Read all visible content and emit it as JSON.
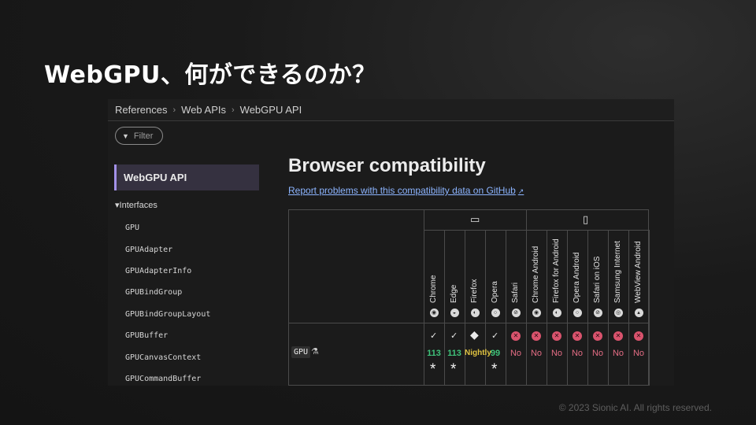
{
  "slide": {
    "title": "WebGPU、何ができるのか？",
    "footer": "© 2023 Sionic AI. All rights reserved."
  },
  "breadcrumb": [
    "References",
    "Web APIs",
    "WebGPU API"
  ],
  "breadcrumb_separator": "›",
  "filter": {
    "label": "Filter",
    "icon": "filter-funnel-icon"
  },
  "sidebar": {
    "active_item": "WebGPU API",
    "group_label": "▾Interfaces",
    "items": [
      "GPU",
      "GPUAdapter",
      "GPUAdapterInfo",
      "GPUBindGroup",
      "GPUBindGroupLayout",
      "GPUBuffer",
      "GPUCanvasContext",
      "GPUCommandBuffer"
    ]
  },
  "content": {
    "heading": "Browser compatibility",
    "report_link": "Report problems with this compatibility data on GitHub"
  },
  "compat_table": {
    "groups": [
      {
        "name": "desktop",
        "icon": "desktop-monitor-icon"
      },
      {
        "name": "mobile",
        "icon": "mobile-phone-icon"
      }
    ],
    "browsers": [
      {
        "name": "Chrome",
        "group": "desktop",
        "icon": "chrome-icon",
        "glyph": "◉",
        "support": "yes",
        "version": "113",
        "note": "*"
      },
      {
        "name": "Edge",
        "group": "desktop",
        "icon": "edge-icon",
        "glyph": "◒",
        "support": "yes",
        "version": "113",
        "note": "*"
      },
      {
        "name": "Firefox",
        "group": "desktop",
        "icon": "firefox-icon",
        "glyph": "◐",
        "support": "preview",
        "version": "Nightly",
        "note": ""
      },
      {
        "name": "Opera",
        "group": "desktop",
        "icon": "opera-icon",
        "glyph": "○",
        "support": "yes",
        "version": "99",
        "note": "*"
      },
      {
        "name": "Safari",
        "group": "desktop",
        "icon": "safari-icon",
        "glyph": "⊘",
        "support": "no",
        "version": "No",
        "note": ""
      },
      {
        "name": "Chrome Android",
        "group": "mobile",
        "icon": "chrome-icon",
        "glyph": "◉",
        "support": "no",
        "version": "No",
        "note": ""
      },
      {
        "name": "Firefox for Android",
        "group": "mobile",
        "icon": "firefox-icon",
        "glyph": "◐",
        "support": "no",
        "version": "No",
        "note": ""
      },
      {
        "name": "Opera Android",
        "group": "mobile",
        "icon": "opera-icon",
        "glyph": "○",
        "support": "no",
        "version": "No",
        "note": ""
      },
      {
        "name": "Safari on iOS",
        "group": "mobile",
        "icon": "safari-icon",
        "glyph": "⊘",
        "support": "no",
        "version": "No",
        "note": ""
      },
      {
        "name": "Samsung Internet",
        "group": "mobile",
        "icon": "samsung-internet-icon",
        "glyph": "◎",
        "support": "no",
        "version": "No",
        "note": ""
      },
      {
        "name": "WebView Android",
        "group": "mobile",
        "icon": "android-icon",
        "glyph": "▴",
        "support": "no",
        "version": "No",
        "note": ""
      }
    ],
    "row_feature": "GPU",
    "row_feature_icon": "experimental-flask-icon",
    "colors": {
      "yes": "#3fc27a",
      "preview": "#e0c341",
      "no": "#d9536d",
      "no_text": "#e46d85"
    }
  }
}
